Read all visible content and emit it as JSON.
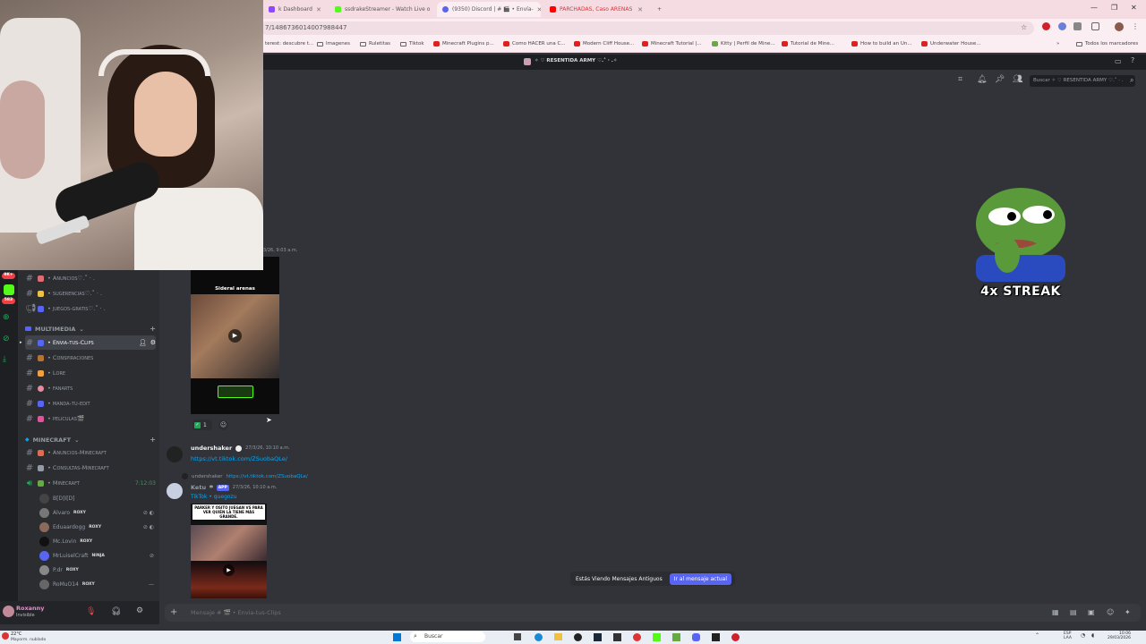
{
  "browser": {
    "tabs": [
      {
        "label": "k Dashboard",
        "color": "#9146ff"
      },
      {
        "label": "ssdrakeStreamer - Watch Live o",
        "color": "#53fc18"
      },
      {
        "label": "(9350) Discord | # 🎬 • Envía-",
        "color": "#5865f2"
      },
      {
        "label": "PARCHADAS, Caso ARENAS",
        "color": "#ff0000"
      }
    ],
    "new_tab": "+",
    "url": "7/1486736014007988447",
    "bookmarks": [
      "terest: descubre t...",
      "Imagenes",
      "Ruletitas",
      "Tiktok",
      "Minecraft Plugins p...",
      "Como HACER una C...",
      "Modern Cliff House...",
      "Minecraft Tutorial |...",
      "Kitty | Perfil de Mine...",
      "Tutorial de Mine...",
      "How to build an Un...",
      "Underwater House..."
    ],
    "all_bookmarks": "Todos los marcadores"
  },
  "discord": {
    "server_title": "✧ ♡ RESENTIDA ARMY ♡.˚ · .✧",
    "search_placeholder": "Buscar ✧ ♡ RESENTIDA ARMY ♡.˚ · .",
    "server_badges": [
      "9K+",
      "583"
    ],
    "channels_top": [
      {
        "label": "• Anuncios♡.˚ · .",
        "color": "#e06c75"
      },
      {
        "label": "• sugerencias♡.˚ · .",
        "color": "#f0c040"
      },
      {
        "label": "• juegos-gratis♡.˚ · .",
        "color": "#5865f2"
      }
    ],
    "category_multimedia": "MULTIMEDIA",
    "channels_multimedia": [
      {
        "label": "• Envia-tus-Clips",
        "color": "#5865f2"
      },
      {
        "label": "• Conspiraciones",
        "color": "#b87333"
      },
      {
        "label": "• Lore",
        "color": "#f0a040"
      },
      {
        "label": "• fanarts",
        "color": "#e88ba0"
      },
      {
        "label": "• manda-tu-edit",
        "color": "#5865f2"
      },
      {
        "label": "• peliculas🎬",
        "color": "#e0559a"
      }
    ],
    "category_minecraft": "MINECRAFT",
    "channels_minecraft": [
      {
        "label": "• Anuncios-Minecraft",
        "color": "#e06c50"
      },
      {
        "label": "• Consultas-Minecraft",
        "color": "#949ba4"
      }
    ],
    "voice_channel": {
      "label": "• Minecraft",
      "time": "7:12:03"
    },
    "voice_users": [
      {
        "name": "B[D]I[D]",
        "tag": ""
      },
      {
        "name": "Alvaro",
        "tag": "ROXY"
      },
      {
        "name": "Eduaardogg",
        "tag": "ROXY"
      },
      {
        "name": "Mc.Lovin",
        "tag": "ROXY"
      },
      {
        "name": "MrLuiselCraft",
        "tag": "NINJA"
      },
      {
        "name": "P.dr",
        "tag": "ROXY"
      },
      {
        "name": "RoMuO14",
        "tag": "ROXY"
      }
    ],
    "user_panel": {
      "name": "Roxanny",
      "status": "Invisible"
    },
    "timestamp_top": "3/26, 9:03 a.m.",
    "video1": {
      "caption": "Sideral arenas",
      "reaction_count": "1"
    },
    "msg1": {
      "user": "undershaker",
      "time": "27/3/26, 10:10 a.m.",
      "link": "https://vt.tiktok.com/ZSuobaQLe/"
    },
    "msg2": {
      "reply_user": "undershaker",
      "reply_link": "https://vt.tiktok.com/ZSuobaQLe/",
      "user": "Ketu",
      "badge": "APP",
      "time": "27/3/26, 10:10 a.m.",
      "embed": "TikTok • quegozu",
      "video_text": "PARKER Y OSITO JUEGAN VS PARA VER QUIÉN LA TIENE MÁS GRANDE."
    },
    "old_messages_banner": "Estás Viendo Mensajes Antiguos",
    "jump_button": "Ir al mensaje actual",
    "message_placeholder": "Mensaje # 🎬 • Envia-tus-Clips",
    "streak": "4x STREAK"
  },
  "taskbar": {
    "weather": "22°C",
    "weather_sub": "Mayorm. nublado",
    "search": "Buscar",
    "lang": "ESP",
    "lang_sub": "LAA",
    "time": "10:06",
    "date": "29/03/2026"
  },
  "colors": {
    "discord_bg": "#313338",
    "sidebar": "#2b2d31",
    "blurple": "#5865f2",
    "link": "#00a8fc"
  }
}
